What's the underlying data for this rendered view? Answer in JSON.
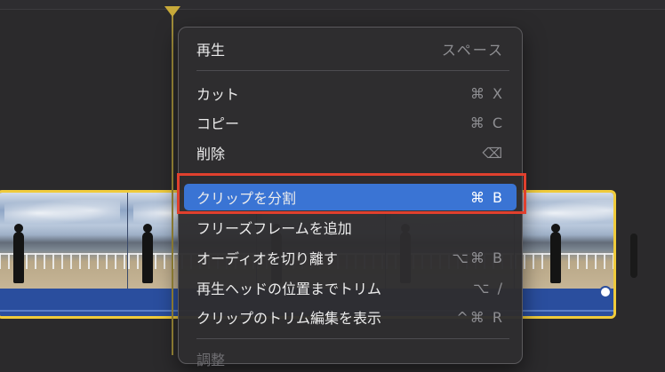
{
  "menu": {
    "items": [
      {
        "label": "再生",
        "shortcut": "スペース"
      },
      {
        "label": "カット",
        "shortcut": "⌘ X"
      },
      {
        "label": "コピー",
        "shortcut": "⌘ C"
      },
      {
        "label": "削除",
        "shortcut": "⌫"
      },
      {
        "label": "クリップを分割",
        "shortcut": "⌘ B"
      },
      {
        "label": "フリーズフレームを追加",
        "shortcut": ""
      },
      {
        "label": "オーディオを切り離す",
        "shortcut": "⌥⌘ B"
      },
      {
        "label": "再生ヘッドの位置までトリム",
        "shortcut": "⌥ /"
      },
      {
        "label": "クリップのトリム編集を表示",
        "shortcut": "^⌘ R"
      },
      {
        "label": "調整",
        "shortcut": ""
      }
    ]
  },
  "colors": {
    "selection": "#3a74d4",
    "annotation": "#e0402e",
    "clip_border": "#f0cb3b"
  }
}
